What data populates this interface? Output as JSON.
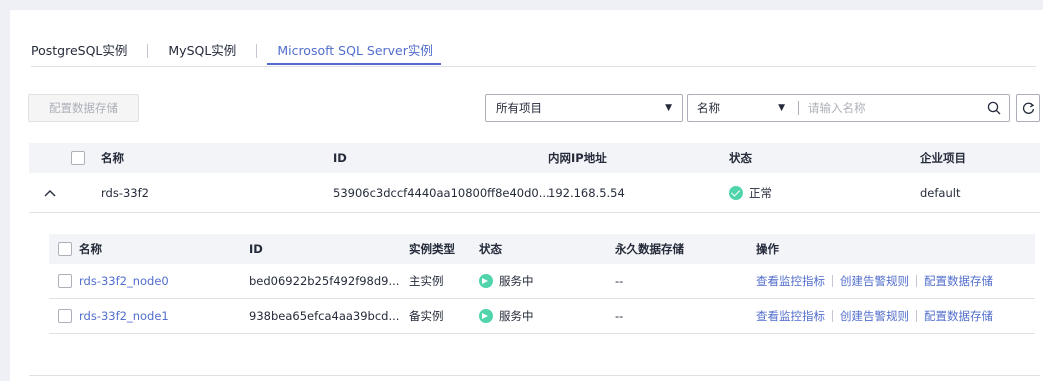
{
  "tabs": [
    {
      "label": "PostgreSQL实例"
    },
    {
      "label": "MySQL实例"
    },
    {
      "label": "Microsoft SQL Server实例"
    }
  ],
  "toolbar": {
    "config_storage_label": "配置数据存储",
    "project_select_value": "所有项目",
    "search_field_value": "名称",
    "search_placeholder": "请输入名称"
  },
  "table": {
    "headers": [
      "名称",
      "ID",
      "内网IP地址",
      "状态",
      "企业项目"
    ],
    "row": {
      "name": "rds-33f2",
      "id": "53906c3dccf4440aa10800ff8e40d0...",
      "ip": "192.168.5.54",
      "status": "正常",
      "project": "default"
    }
  },
  "nodes": {
    "headers": [
      "名称",
      "ID",
      "实例类型",
      "状态",
      "永久数据存储",
      "操作"
    ],
    "rows": [
      {
        "name": "rds-33f2_node0",
        "id": "bed06922b25f492f98d9...",
        "type": "主实例",
        "status": "服务中",
        "storage": "--",
        "ops": [
          "查看监控指标",
          "创建告警规则",
          "配置数据存储"
        ]
      },
      {
        "name": "rds-33f2_node1",
        "id": "938bea65efca4aa39bcd...",
        "type": "备实例",
        "status": "服务中",
        "storage": "--",
        "ops": [
          "查看监控指标",
          "创建告警规则",
          "配置数据存储"
        ]
      }
    ]
  },
  "colors": {
    "accent": "#526ecc",
    "ok": "#50d4ab"
  }
}
